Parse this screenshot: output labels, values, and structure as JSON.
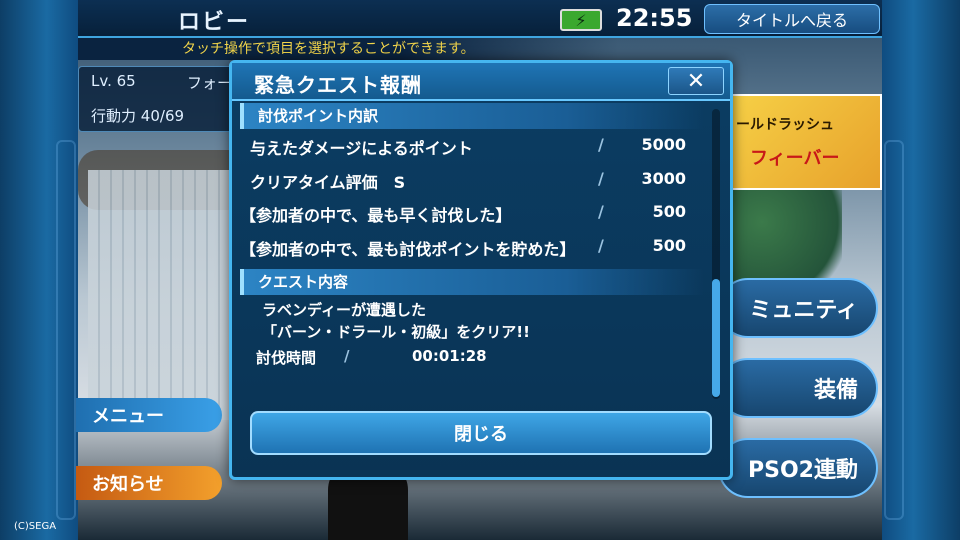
{
  "header": {
    "title": "ロビー",
    "clock": "22:55",
    "back_to_title": "タイトルへ戻る",
    "battery_icon": "battery-charging-icon"
  },
  "hint": "タッチ操作で項目を選択することができます。",
  "player": {
    "level": "Lv. 65",
    "class": "フォー",
    "action_points_label": "行動力",
    "action_points": "40/69"
  },
  "left_buttons": {
    "menu": "メニュー",
    "news": "お知らせ"
  },
  "right_buttons": {
    "community": "ミュニティ",
    "equip": "装備",
    "pso2_link": "PSO2連動"
  },
  "banner": {
    "line1": "ールドラッシュ",
    "line2": "フィーバー"
  },
  "copyright": "(C)SEGA",
  "modal": {
    "title": "緊急クエスト報酬",
    "points_section": "討伐ポイント内訳",
    "rows": [
      {
        "label": "与えたダメージによるポイント",
        "value": "5000"
      },
      {
        "label": "クリアタイム評価　S",
        "value": "3000"
      },
      {
        "label": "【参加者の中で、最も早く討伐した】",
        "value": "500"
      },
      {
        "label": "【参加者の中で、最も討伐ポイントを貯めた】",
        "value": "500"
      }
    ],
    "slash": "/",
    "quest_section": "クエスト内容",
    "quest_lines": [
      "ラベンディーが遭遇した",
      "「バーン・ドラール・初級」をクリア!!"
    ],
    "time_label": "討伐時間",
    "time_value": "00:01:28",
    "close_label": "閉じる",
    "close_icon": "close-x-icon"
  }
}
